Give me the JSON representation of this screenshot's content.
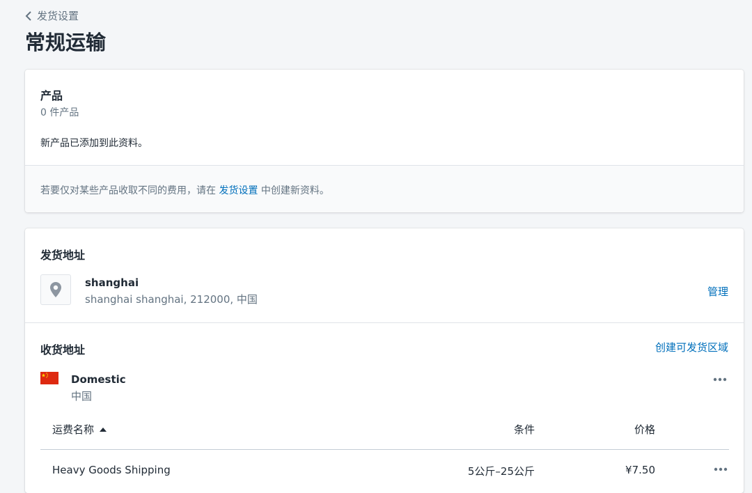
{
  "breadcrumb": {
    "label": "发货设置"
  },
  "page": {
    "title": "常规运输"
  },
  "products_card": {
    "title": "产品",
    "count_text": "0 件产品",
    "info_text": "新产品已添加到此资料。",
    "footer": {
      "prefix": "若要仅对某些产品收取不同的费用，请在",
      "link": "发货设置",
      "suffix": "中创建新资料。"
    }
  },
  "ship_from": {
    "title": "发货地址",
    "location_name": "shanghai",
    "location_address": "shanghai shanghai, 212000, 中国",
    "manage_label": "管理"
  },
  "ship_to": {
    "title": "收货地址",
    "create_zone_label": "创建可发货区域",
    "zone": {
      "name": "Domestic",
      "country": "中国",
      "more_label": "•••"
    },
    "table": {
      "headers": {
        "name": "运费名称",
        "condition": "条件",
        "price": "价格"
      },
      "rows": [
        {
          "name": "Heavy Goods Shipping",
          "condition": "5公斤–25公斤",
          "price": "¥7.50",
          "more_label": "•••"
        }
      ]
    }
  },
  "colors": {
    "link": "#006fbb",
    "background": "#f4f6f8",
    "flag_red": "#de2910",
    "flag_star": "#ffde00"
  },
  "icons": {
    "back": "chevron-left-icon",
    "location": "location-pin-icon",
    "sort": "sort-ascending-icon",
    "more": "more-horizontal-icon",
    "flag": "china-flag-icon"
  }
}
